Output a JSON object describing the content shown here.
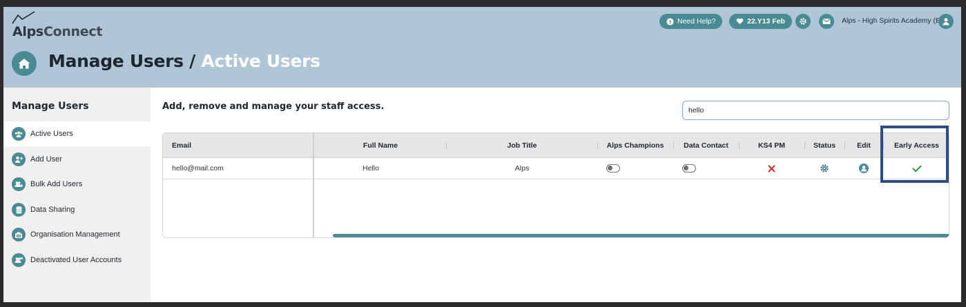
{
  "app": {
    "logo_word1": "Alps",
    "logo_word2": "Connect"
  },
  "header": {
    "help_label": "Need Help?",
    "data_label": "22.Y13 Feb",
    "school": "Alps - High Spirits Academy (E)",
    "title_main": "Manage Users",
    "title_sep": "/",
    "title_active": "Active Users"
  },
  "sidebar": {
    "title": "Manage Users",
    "items": [
      {
        "label": "Active Users",
        "icon": "users-icon"
      },
      {
        "label": "Add User",
        "icon": "user-plus-icon"
      },
      {
        "label": "Bulk Add Users",
        "icon": "users-plus-icon"
      },
      {
        "label": "Data Sharing",
        "icon": "database-icon"
      },
      {
        "label": "Organisation Management",
        "icon": "organisation-icon"
      },
      {
        "label": "Deactivated User Accounts",
        "icon": "users-x-icon"
      }
    ]
  },
  "main": {
    "subtitle": "Add, remove and manage your staff access.",
    "search_value": "hello"
  },
  "table": {
    "columns": [
      "Email",
      "Full Name",
      "Job Title",
      "Alps Champions",
      "Data Contact",
      "KS4 PM",
      "Status",
      "Edit",
      "Early Access"
    ],
    "rows": [
      {
        "email": "hello@mail.com",
        "full_name": "Hello",
        "job_title": "Alps",
        "alps_champions": false,
        "data_contact": false,
        "ks4_pm": false,
        "early_access": true
      }
    ]
  },
  "colors": {
    "accent": "#4a8a93",
    "header_bg": "#aec6d5",
    "cross": "#d9342b",
    "check": "#3aa04a",
    "highlight": "#2d4a8a"
  }
}
